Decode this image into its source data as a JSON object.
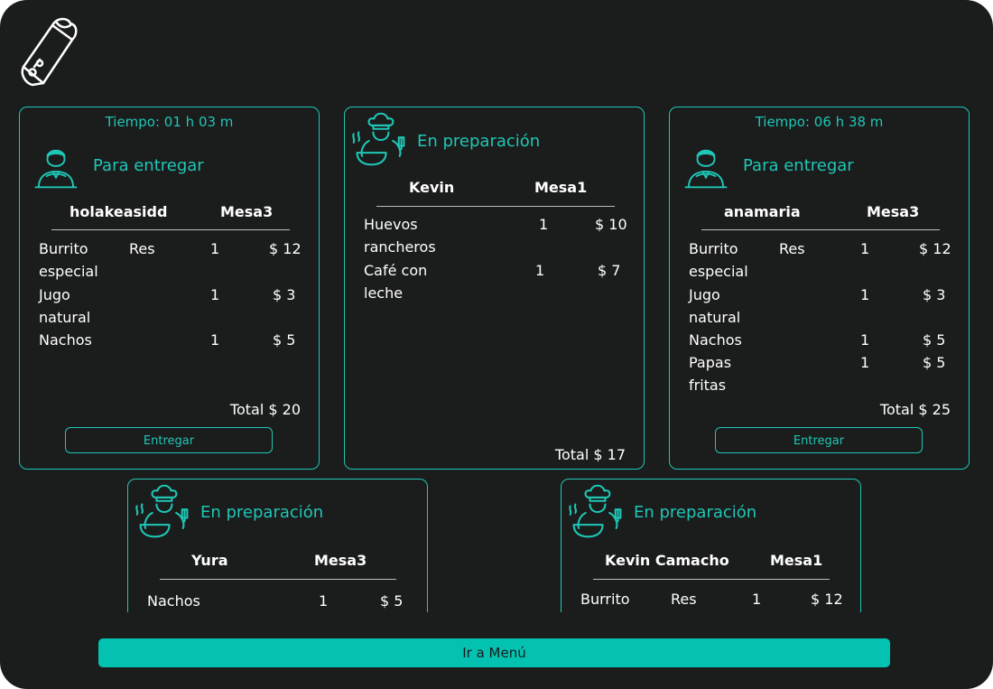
{
  "menu_button": {
    "label": "Ir a Menú"
  },
  "colors": {
    "accent": "#1fc7b6",
    "button_fill": "#03c2b1",
    "background": "#1b1c1c"
  },
  "orders": [
    {
      "timer": "Tiempo: 01 h 03 m",
      "status": "Para entregar",
      "status_icon": "waiter-icon",
      "customer": "holakeasidd",
      "table": "Mesa3",
      "items": [
        {
          "name": "Burrito especial",
          "variant": "Res",
          "qty": "1",
          "price": "$ 12"
        },
        {
          "name": "Jugo natural",
          "variant": "",
          "qty": "1",
          "price": "$ 3"
        },
        {
          "name": "Nachos",
          "variant": "",
          "qty": "1",
          "price": "$ 5"
        }
      ],
      "total": "Total $ 20",
      "action": "Entregar"
    },
    {
      "status": "En preparación",
      "status_icon": "chef-icon",
      "customer": "Kevin",
      "table": "Mesa1",
      "items": [
        {
          "name": "Huevos rancheros",
          "variant": "",
          "qty": "1",
          "price": "$ 10"
        },
        {
          "name": "Café con leche",
          "variant": "",
          "qty": "1",
          "price": "$ 7"
        }
      ],
      "total": "Total $ 17"
    },
    {
      "timer": "Tiempo: 06 h 38 m",
      "status": "Para entregar",
      "status_icon": "waiter-icon",
      "customer": "anamaria",
      "table": "Mesa3",
      "items": [
        {
          "name": "Burrito especial",
          "variant": "Res",
          "qty": "1",
          "price": "$ 12"
        },
        {
          "name": "Jugo natural",
          "variant": "",
          "qty": "1",
          "price": "$ 3"
        },
        {
          "name": "Nachos",
          "variant": "",
          "qty": "1",
          "price": "$ 5"
        },
        {
          "name": "Papas fritas",
          "variant": "",
          "qty": "1",
          "price": "$ 5"
        }
      ],
      "total": "Total $ 25",
      "action": "Entregar"
    },
    {
      "status": "En preparación",
      "status_icon": "chef-icon",
      "customer": "Yura",
      "table": "Mesa3",
      "items": [
        {
          "name": "Nachos",
          "variant": "",
          "qty": "1",
          "price": "$ 5"
        }
      ]
    },
    {
      "status": "En preparación",
      "status_icon": "chef-icon",
      "customer": "Kevin Camacho",
      "table": "Mesa1",
      "items": [
        {
          "name": "Burrito",
          "variant": "Res",
          "qty": "1",
          "price": "$ 12"
        }
      ]
    }
  ]
}
